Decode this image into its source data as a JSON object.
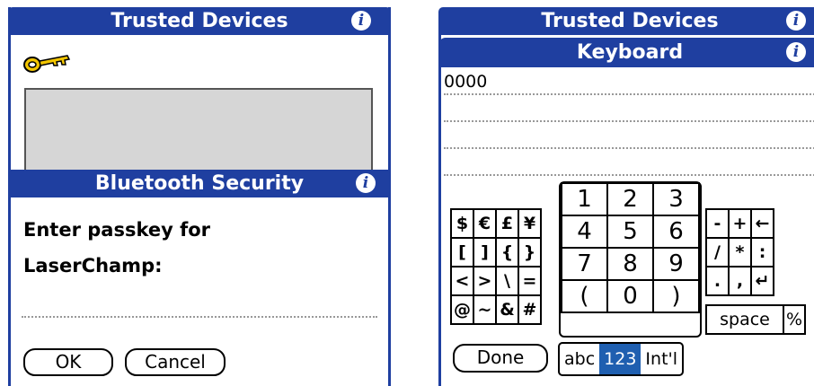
{
  "left": {
    "title": "Trusted Devices",
    "info_glyph": "i",
    "dialog": {
      "title": "Bluetooth Security",
      "prompt_line1": "Enter passkey for",
      "prompt_line2": "LaserChamp:",
      "ok_label": "OK",
      "cancel_label": "Cancel"
    }
  },
  "right": {
    "title": "Trusted Devices",
    "keyboard_title": "Keyboard",
    "passkey_text": "0000",
    "symbols": [
      [
        "$",
        "€",
        "£",
        "¥"
      ],
      [
        "[",
        "]",
        "{",
        "}"
      ],
      [
        "<",
        ">",
        "\\",
        "="
      ],
      [
        "@",
        "~",
        "&",
        "#"
      ]
    ],
    "numbers": [
      [
        "1",
        "2",
        "3"
      ],
      [
        "4",
        "5",
        "6"
      ],
      [
        "7",
        "8",
        "9"
      ],
      [
        "(",
        "0",
        ")"
      ]
    ],
    "ops": [
      [
        "-",
        "+",
        "←"
      ],
      [
        "/",
        "*",
        ":"
      ],
      [
        ".",
        ",",
        "↵"
      ]
    ],
    "space_label": "space",
    "percent_label": "%",
    "done_label": "Done",
    "modes": [
      "abc",
      "123",
      "Int'l"
    ],
    "selected_mode": "123"
  },
  "colors": {
    "titlebar": "#1f3fa0",
    "selected_mode": "#1f5fb0"
  }
}
